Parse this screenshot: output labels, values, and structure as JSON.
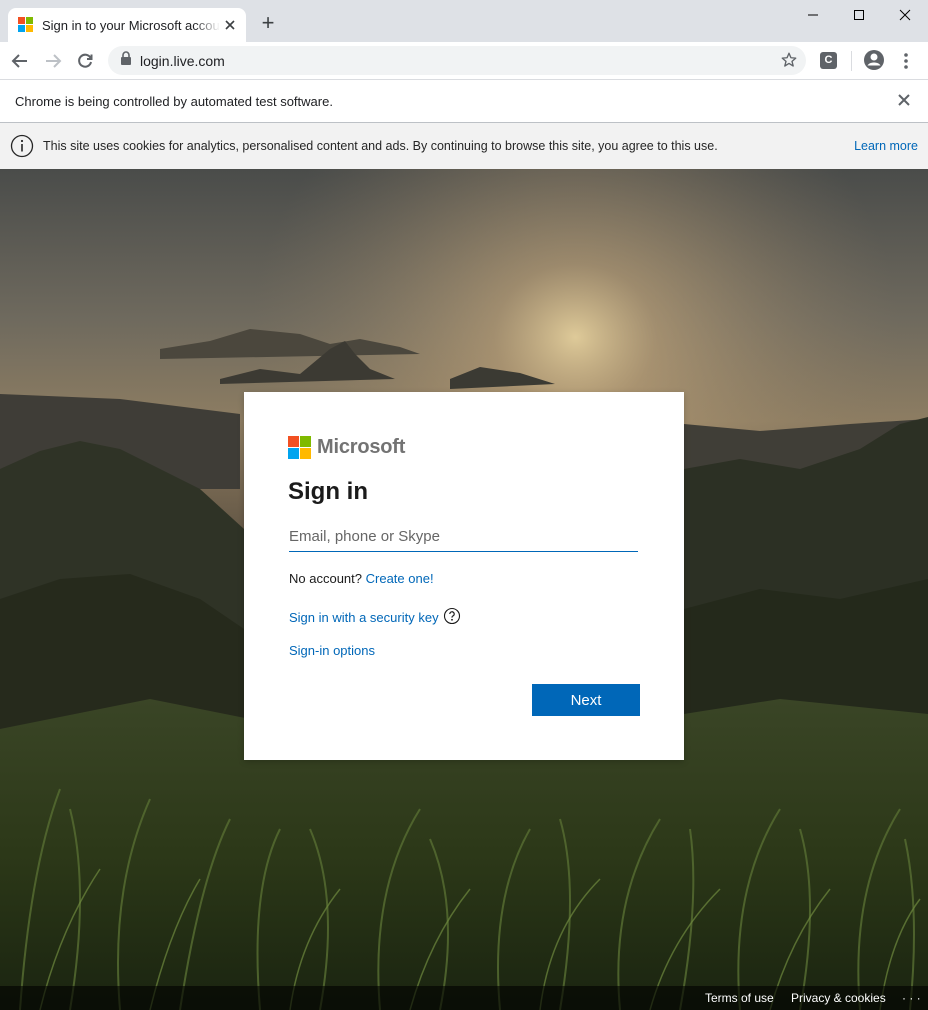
{
  "browser": {
    "tab_title": "Sign in to your Microsoft account",
    "new_tab_symbol": "+",
    "url": "login.live.com",
    "extension_label": "C",
    "infobar_text": "Chrome is being controlled by automated test software."
  },
  "cookie_banner": {
    "text": "This site uses cookies for analytics, personalised content and ads. By continuing to browse this site, you agree to this use.",
    "link": "Learn more"
  },
  "signin": {
    "brand": "Microsoft",
    "title": "Sign in",
    "email_placeholder": "Email, phone or Skype",
    "no_account_text": "No account?",
    "create_link": "Create one!",
    "security_key_link": "Sign in with a security key",
    "options_link": "Sign-in options",
    "next_label": "Next"
  },
  "footer": {
    "terms": "Terms of use",
    "privacy": "Privacy & cookies",
    "more": "· · ·"
  },
  "colors": {
    "accent": "#0067b8",
    "ms_red": "#f25022",
    "ms_green": "#7fba00",
    "ms_blue": "#00a4ef",
    "ms_yellow": "#ffb900"
  },
  "icons": [
    "microsoft-logo-icon",
    "close-icon",
    "back-arrow-icon",
    "forward-arrow-icon",
    "reload-icon",
    "lock-icon",
    "star-icon",
    "profile-icon",
    "more-vert-icon",
    "info-icon",
    "help-circle-icon",
    "minimize-icon",
    "maximize-icon"
  ]
}
